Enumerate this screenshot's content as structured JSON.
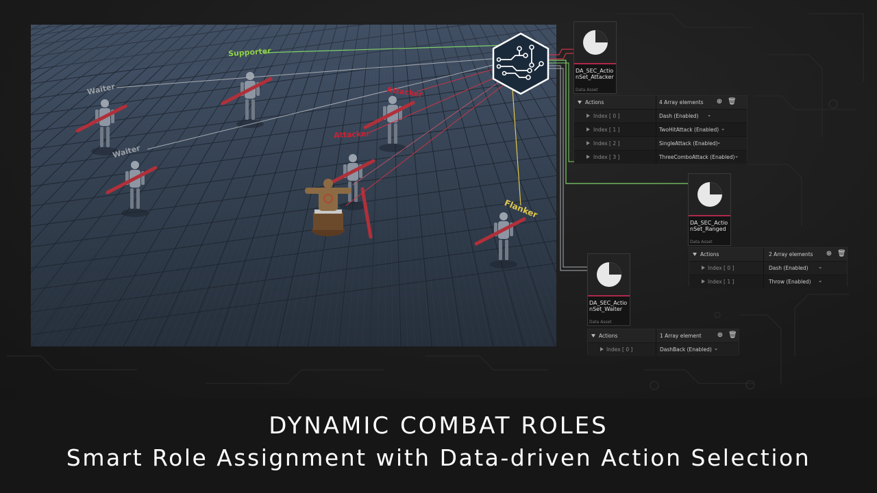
{
  "title": "DYNAMIC COMBAT ROLES",
  "subtitle": "Smart Role Assignment with Data-driven Action Selection",
  "scene": {
    "labels": {
      "supporter": "Supporter",
      "waiter1": "Waiter",
      "waiter2": "Waiter",
      "attacker1": "Attacker",
      "attacker2": "Attacker",
      "flanker": "Flanker"
    },
    "colors": {
      "supporter": "#8fd14a",
      "waiter": "#9aa0a6",
      "attacker": "#cc2233",
      "flanker": "#e2c84a"
    }
  },
  "assets": {
    "attacker": {
      "name": "DA_SEC_ActionSet_Attacker",
      "type": "Data Asset",
      "actions_label": "Actions",
      "count_label": "4 Array elements",
      "rows": [
        {
          "index": "Index [ 0 ]",
          "value": "Dash (Enabled)"
        },
        {
          "index": "Index [ 1 ]",
          "value": "TwoHitAttack (Enabled)"
        },
        {
          "index": "Index [ 2 ]",
          "value": "SingleAttack (Enabled)"
        },
        {
          "index": "Index [ 3 ]",
          "value": "ThreeComboAttack (Enabled)"
        }
      ]
    },
    "ranged": {
      "name": "DA_SEC_ActionSet_Ranged",
      "type": "Data Asset",
      "actions_label": "Actions",
      "count_label": "2 Array elements",
      "rows": [
        {
          "index": "Index [ 0 ]",
          "value": "Dash (Enabled)"
        },
        {
          "index": "Index [ 1 ]",
          "value": "Throw (Enabled)"
        }
      ]
    },
    "waiter": {
      "name": "DA_SEC_ActionSet_Waiter",
      "type": "Data Asset",
      "actions_label": "Actions",
      "count_label": "1 Array element",
      "rows": [
        {
          "index": "Index [ 0 ]",
          "value": "DashBack (Enabled)"
        }
      ]
    }
  },
  "icons": [
    "pie-chart-icon",
    "circuit-brain-icon",
    "add-icon",
    "trash-icon",
    "chevron-down-icon",
    "expand-arrow-icon"
  ]
}
